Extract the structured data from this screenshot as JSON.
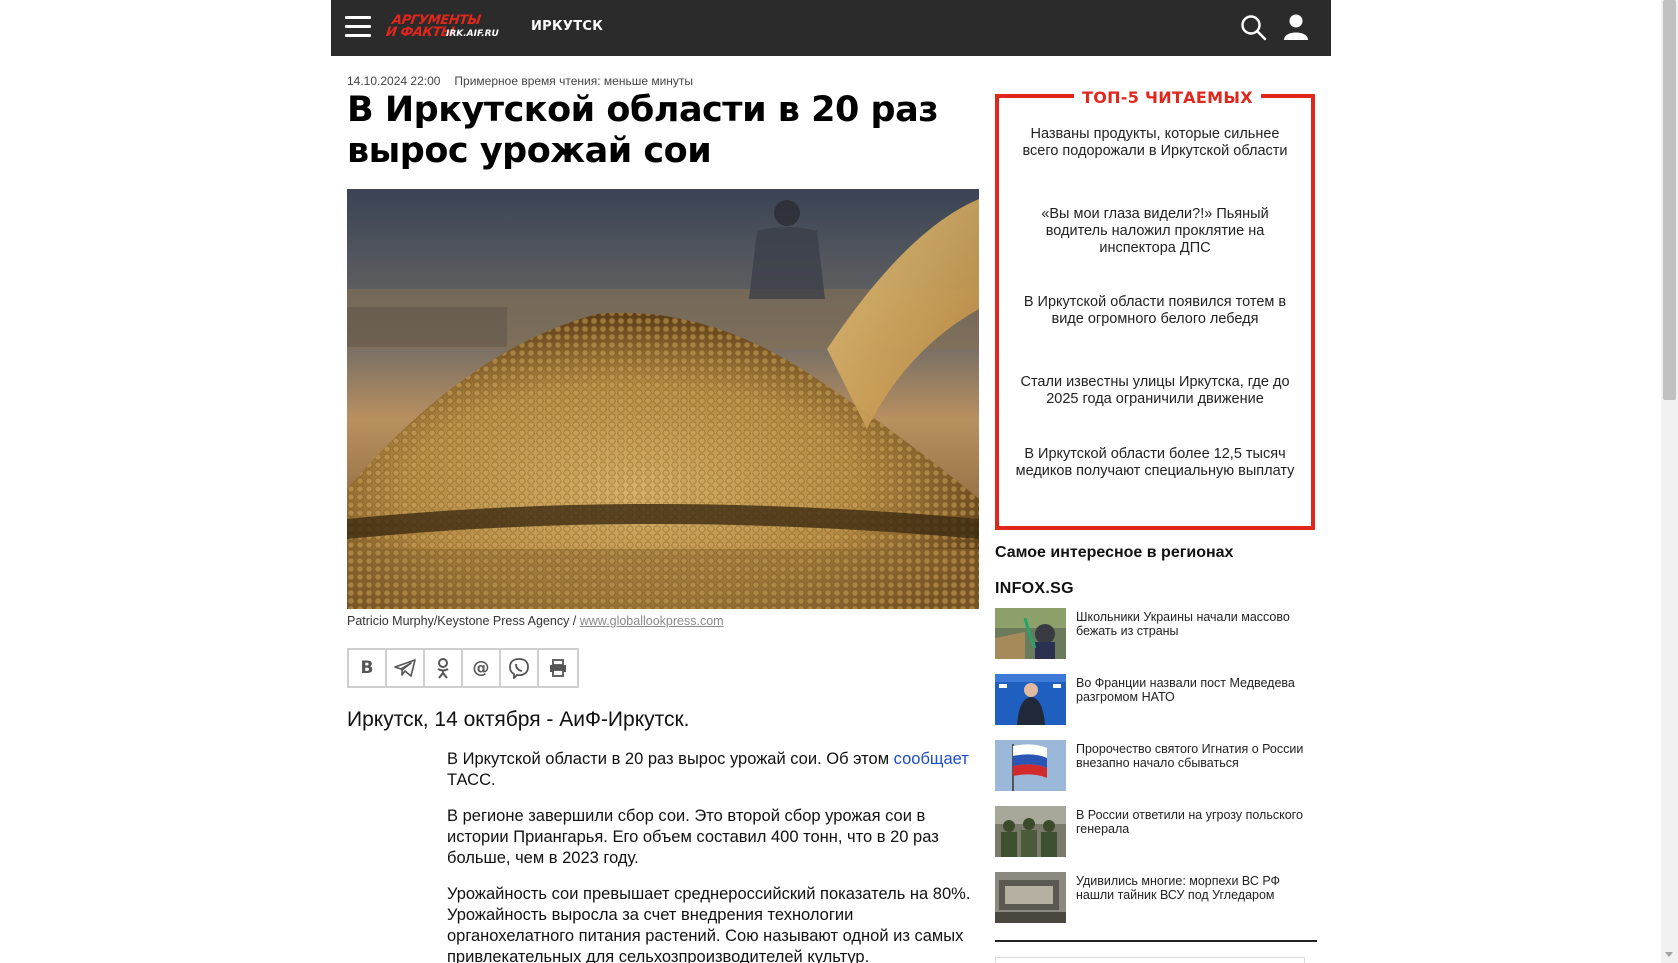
{
  "header": {
    "logo_line1": "АРГУМЕНТЫ",
    "logo_line2": "И ФАКТЫ",
    "logo_domain": "IRK.AIF.RU",
    "city": "ИРКУТСК",
    "icons": [
      "menu-icon",
      "search-icon",
      "user-icon"
    ]
  },
  "article": {
    "date": "14.10.2024 22:00",
    "reading_time": "Примерное время чтения: меньше минуты",
    "title": "В Иркутской области в 20 раз вырос урожай сои",
    "photo_credit": "Patricio Murphy/Keystone Press Agency / ",
    "photo_link": "www.globallookpress.com",
    "share_buttons": [
      "В",
      "telegram",
      "ok",
      "@",
      "viber",
      "print"
    ],
    "lead": "Иркутск, 14 октября - АиФ-Иркутск.",
    "p1_text": "В Иркутской области в 20 раз вырос урожай сои. Об этом ",
    "p1_link": "сообщает",
    "p1_tail": " ТАСС.",
    "p2": "В регионе завершили сбор сои. Это второй сбор урожая сои в истории Приангарья. Его объем составил 400 тонн, что в 20 раз больше, чем в 2023 году.",
    "p3": "Урожайность сои превышает среднероссийский показатель на 80%. Урожайность выросла за счет внедрения технологии органохелатного питания растений. Сою называют одной из самых привлекательных для сельхозпроизводителей культур."
  },
  "top5": {
    "title": "ТОП-5 ЧИТАЕМЫХ",
    "items": [
      "Названы продукты, которые сильнее всего подорожали в Иркутской области",
      "«Вы мои глаза видели?!» Пьяный водитель наложил проклятие на инспектора ДПС",
      "В Иркутской области появился тотем в виде огромного белого лебедя",
      "Стали известны улицы Иркутска, где до 2025 года ограничили движение",
      "В Иркутской области более 12,5 тысяч медиков получают специальную выплату"
    ]
  },
  "regions": {
    "title": "Самое интересное в регионах",
    "source": "INFOX.SG",
    "items": [
      "Школьники Украины начали массово бежать из страны",
      "Во Франции назвали пост Медведева разгромом НАТО",
      "Пророчество святого Игнатия о России внезапно начало сбываться",
      "В России ответили на угрозу польского генерала",
      "Удивились многие: морпехи ВС РФ нашли тайник ВСУ под Угледаром"
    ]
  },
  "colors": {
    "brand_red": "#e1261c",
    "topbar": "#2b2b2b",
    "link": "#1a4cc8"
  }
}
